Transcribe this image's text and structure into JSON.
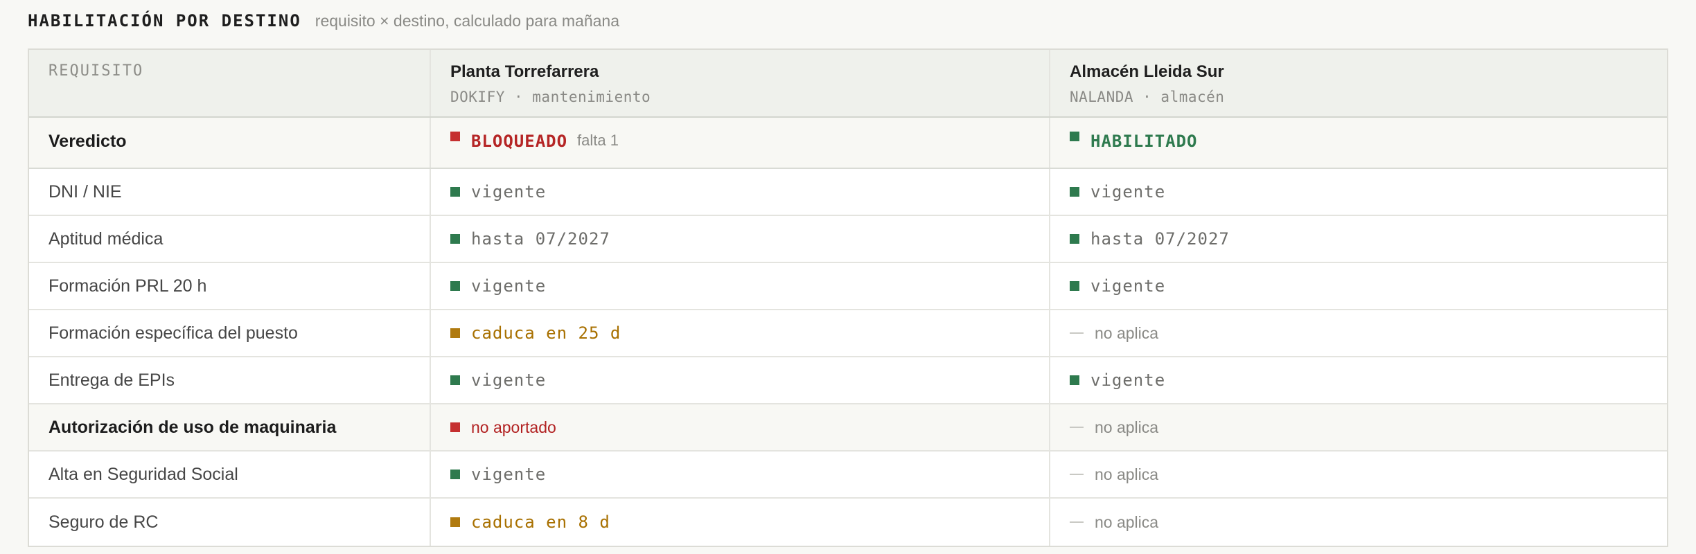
{
  "header": {
    "title": "HABILITACIÓN POR DESTINO",
    "subtitle": "requisito × destino, calculado para mañana"
  },
  "columns": {
    "requirement_label": "REQUISITO",
    "destinations": [
      {
        "name": "Planta Torrefarrera",
        "meta": "DOKIFY · mantenimiento"
      },
      {
        "name": "Almacén Lleida Sur",
        "meta": "NALANDA · almacén"
      }
    ]
  },
  "verdict": {
    "label": "Veredicto",
    "values": [
      {
        "status": "BLOQUEADO",
        "note": "falta 1"
      },
      {
        "status": "HABILITADO",
        "note": ""
      }
    ]
  },
  "rows": [
    {
      "label": "DNI / NIE",
      "values": [
        "vigente",
        "vigente"
      ]
    },
    {
      "label": "Aptitud médica",
      "values": [
        "hasta 07/2027",
        "hasta 07/2027"
      ]
    },
    {
      "label": "Formación PRL 20 h",
      "values": [
        "vigente",
        "vigente"
      ]
    },
    {
      "label": "Formación específica del puesto",
      "values": [
        "caduca en 25 d",
        "no aplica"
      ]
    },
    {
      "label": "Entrega de EPIs",
      "values": [
        "vigente",
        "vigente"
      ]
    },
    {
      "label": "Autorización de uso de maquinaria",
      "values": [
        "no aportado",
        "no aplica"
      ]
    },
    {
      "label": "Alta en Seguridad Social",
      "values": [
        "vigente",
        "no aplica"
      ]
    },
    {
      "label": "Seguro de RC",
      "values": [
        "caduca en 8 d",
        "no aplica"
      ]
    }
  ],
  "colors": {
    "ok": "#2e7a4e",
    "warning": "#b07a0f",
    "error": "#c53030",
    "not_applicable": "#c9c9c4"
  }
}
